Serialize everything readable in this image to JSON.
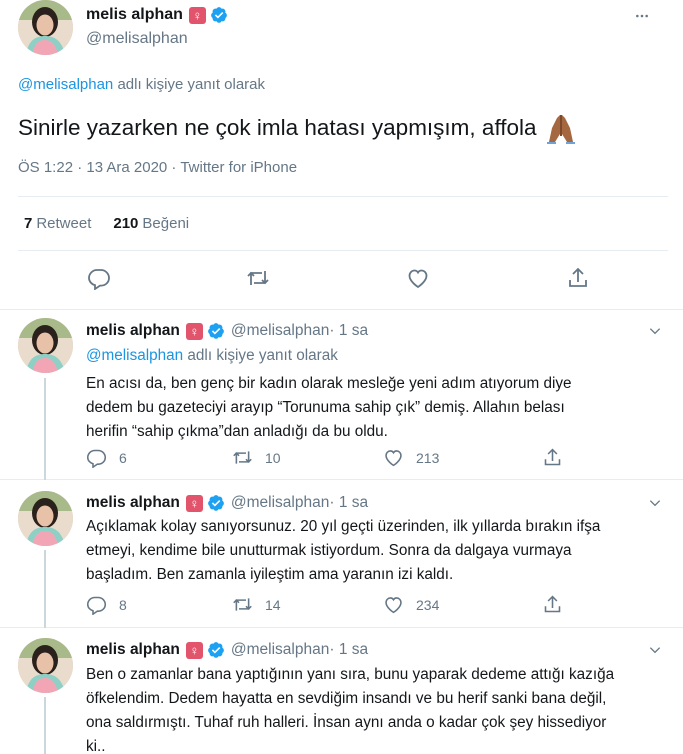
{
  "main_tweet": {
    "display_name": "melis alphan",
    "gender_badge": "♀",
    "handle": "@melisalphan",
    "reply_to": {
      "mention": "@melisalphan",
      "rest": " adlı kişiye yanıt olarak"
    },
    "text": "Sinirle yazarken ne çok imla hatası yapmışım, affola",
    "emoji": "folded-hands-icon",
    "meta": "ÖS 1:22 · 13 Ara 2020 · Twitter for iPhone",
    "retweets": {
      "count": "7",
      "label": "Retweet"
    },
    "likes": {
      "count": "210",
      "label": "Beğeni"
    }
  },
  "replies": [
    {
      "display_name": "melis alphan",
      "gender_badge": "♀",
      "handle": "@melisalphan",
      "time": " · 1 sa",
      "reply_to": {
        "mention": "@melisalphan",
        "rest": " adlı kişiye yanıt olarak"
      },
      "lines": [
        "En acısı da, ben genç bir kadın olarak mesleğe yeni adım atıyorum diye",
        "dedem bu gazeteciyi arayıp “Torunuma sahip çık” demiş. Allahın belası",
        "herifin “sahip çıkma”dan anladığı da bu oldu."
      ],
      "replies_count": "6",
      "retweets_count": "10",
      "likes_count": "213"
    },
    {
      "display_name": "melis alphan",
      "gender_badge": "♀",
      "handle": "@melisalphan",
      "time": " · 1 sa",
      "lines": [
        "Açıklamak kolay sanıyorsunuz. 20 yıl geçti üzerinden, ilk yıllarda bırakın ifşa",
        "etmeyi, kendime bile unutturmak istiyordum. Sonra da dalgaya vurmaya",
        "başladım. Ben zamanla iyileştim ama yaranın izi kaldı."
      ],
      "replies_count": "8",
      "retweets_count": "14",
      "likes_count": "234"
    },
    {
      "display_name": "melis alphan",
      "gender_badge": "♀",
      "handle": "@melisalphan",
      "time": " · 1 sa",
      "lines": [
        "Ben o zamanlar bana yaptığının yanı sıra, bunu yaparak dedeme attığı kazığa",
        "öfkelendim. Dedem hayatta en sevdiğim insandı ve bu herif sanki bana değil,",
        "ona saldırmıştı. Tuhaf ruh halleri. İnsan aynı anda o kadar çok şey hissediyor",
        "ki.."
      ]
    }
  ],
  "colors": {
    "text": "#14171a",
    "secondary": "#657786",
    "link": "#1b95e0",
    "verified": "#1da1f2",
    "gender_badge_bg": "#e2546b",
    "divider": "#e6ecf0"
  }
}
